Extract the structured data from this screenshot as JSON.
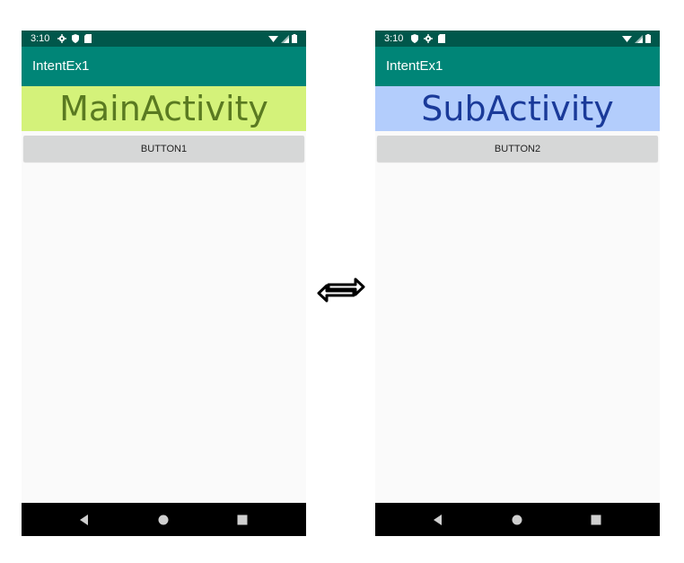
{
  "left_phone": {
    "status_time": "3:10",
    "app_title": "IntentEx1",
    "activity_label": "MainActivity",
    "button_label": "BUTTON1"
  },
  "right_phone": {
    "status_time": "3:10",
    "app_title": "IntentEx1",
    "activity_label": "SubActivity",
    "button_label": "BUTTON2"
  },
  "icons": {
    "status_left": [
      "gear-icon",
      "shield-icon",
      "sdcard-icon"
    ],
    "status_right": [
      "wifi-icon",
      "cell-signal-icon",
      "battery-icon"
    ],
    "nav": [
      "back-icon",
      "home-icon",
      "recents-icon"
    ],
    "center": "swap-arrows-icon"
  },
  "colors": {
    "status_bar": "#00574b",
    "app_bar": "#008577",
    "main_banner_bg": "#d4f27a",
    "main_banner_text": "#5a7a21",
    "sub_banner_bg": "#b3cdfc",
    "sub_banner_text": "#1a3a99",
    "button_bg": "#d6d7d7"
  }
}
